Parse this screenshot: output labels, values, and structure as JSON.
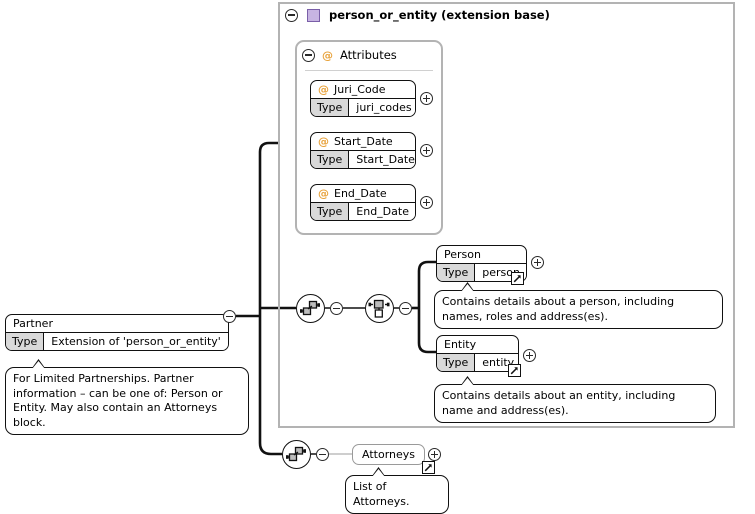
{
  "diagram": {
    "title": "person_or_entity (extension base)",
    "base_icon": "complex-type-square-icon",
    "accent_purple": "#c7b4e2",
    "type_label": "Type"
  },
  "attributes_group": {
    "label": "Attributes",
    "icon": "attribute-at-icon",
    "items": [
      {
        "name": "Juri_Code",
        "type_label": "Type",
        "type_value": "juri_codes"
      },
      {
        "name": "Start_Date",
        "type_label": "Type",
        "type_value": "Start_Date"
      },
      {
        "name": "End_Date",
        "type_label": "Type",
        "type_value": "End_Date"
      }
    ]
  },
  "partner": {
    "name": "Partner",
    "type_label": "Type",
    "type_value": "Extension of 'person_or_entity'",
    "annotation": "For Limited Partnerships. Partner information – can be one of: Person or Entity. May also contain an Attorneys block."
  },
  "compositors": {
    "sequence_main": "sequence-compositor-icon",
    "choice": "choice-compositor-icon",
    "sequence_attorneys": "sequence-compositor-icon"
  },
  "choice_children": [
    {
      "name": "Person",
      "type_label": "Type",
      "type_value": "person",
      "link_icon": "external-link-icon",
      "annotation": "Contains details about a person, including names, roles and address(es)."
    },
    {
      "name": "Entity",
      "type_label": "Type",
      "type_value": "entity",
      "link_icon": "external-link-icon",
      "annotation": "Contains details about an entity, including name and address(es)."
    }
  ],
  "attorneys": {
    "name": "Attorneys",
    "link_icon": "external-link-icon",
    "annotation": "List of Attorneys."
  }
}
